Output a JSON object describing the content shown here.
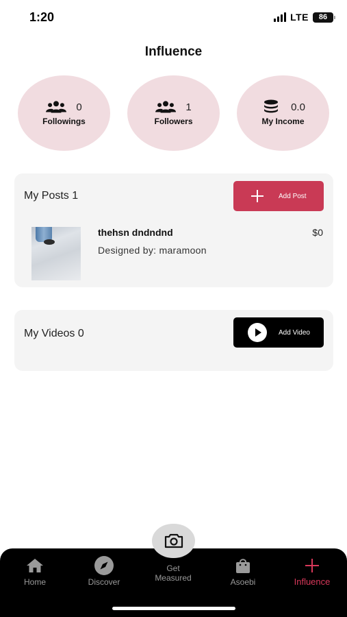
{
  "status_bar": {
    "time": "1:20",
    "network": "LTE",
    "battery": "86"
  },
  "header": {
    "title": "Influence"
  },
  "stats": [
    {
      "icon": "group-icon",
      "value": "0",
      "label": "Followings"
    },
    {
      "icon": "group-icon",
      "value": "1",
      "label": "Followers"
    },
    {
      "icon": "coins-icon",
      "value": "0.0",
      "label": "My Income"
    }
  ],
  "posts": {
    "title": "My Posts 1",
    "button_label": "Add Post",
    "items": [
      {
        "name": "thehsn dndndnd",
        "designer": "Designed by: maramoon",
        "price": "$0"
      }
    ]
  },
  "videos": {
    "title": "My Videos 0",
    "button_label": "Add Video"
  },
  "nav": {
    "items": [
      {
        "label": "Home",
        "icon": "home-icon"
      },
      {
        "label": "Discover",
        "icon": "compass-icon"
      },
      {
        "label": "Get Measured",
        "icon": "camera-icon"
      },
      {
        "label": "Asoebi",
        "icon": "shopping-bag-icon"
      },
      {
        "label": "Influence",
        "icon": "plus-icon"
      }
    ]
  },
  "colors": {
    "accent": "#c93a55",
    "stat_bg": "#f1dce0",
    "active_nav": "#d8385a"
  }
}
